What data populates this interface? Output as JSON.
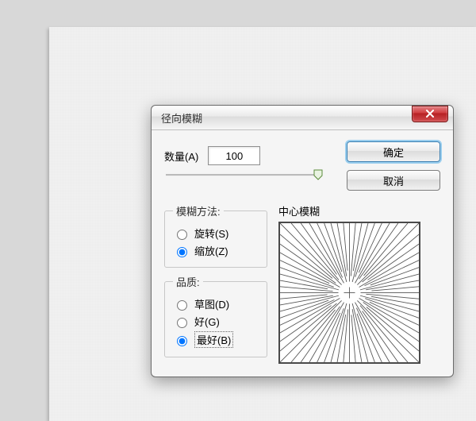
{
  "dialog": {
    "title": "径向模糊",
    "amount": {
      "label": "数量(A)",
      "value": "100"
    },
    "buttons": {
      "ok": "确定",
      "cancel": "取消"
    },
    "method": {
      "legend": "模糊方法:",
      "options": {
        "spin": {
          "label": "旋转(S)",
          "selected": false
        },
        "zoom": {
          "label": "缩放(Z)",
          "selected": true
        }
      }
    },
    "quality": {
      "legend": "品质:",
      "options": {
        "draft": {
          "label": "草图(D)",
          "selected": false
        },
        "good": {
          "label": "好(G)",
          "selected": false
        },
        "best": {
          "label": "最好(B)",
          "selected": true
        }
      }
    },
    "preview": {
      "label": "中心模糊"
    }
  }
}
